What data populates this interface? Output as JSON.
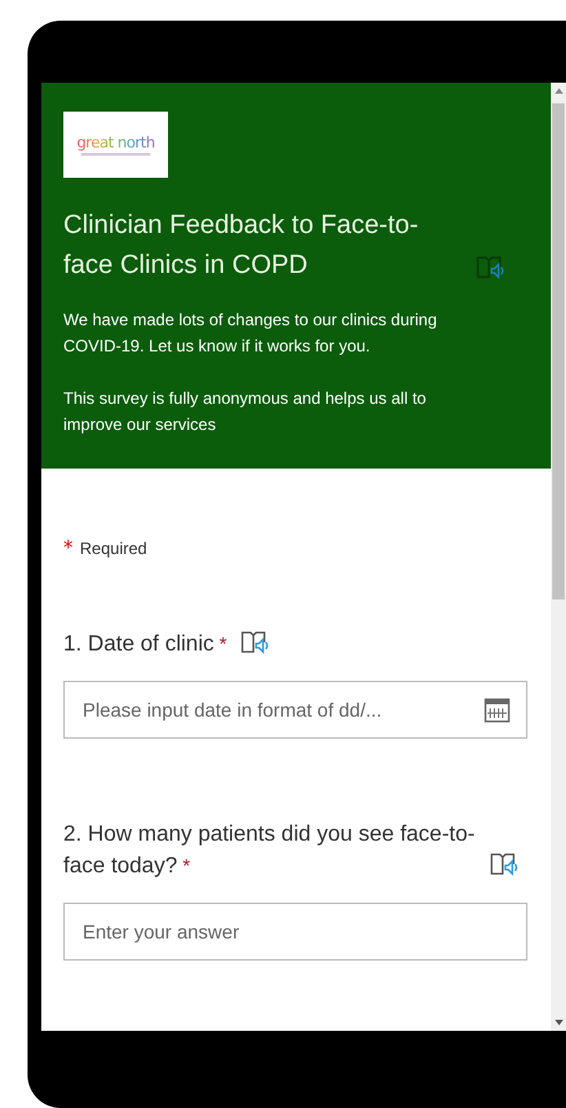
{
  "header": {
    "logo": {
      "text": "great north"
    },
    "title": "Clinician Feedback to Face-to-face Clinics in COPD",
    "paragraphs": [
      "We have made lots of changes to our clinics during COVID-19. Let us know if it works for you.",
      "This survey is fully anonymous and helps us all to improve our services"
    ]
  },
  "required_note": {
    "mark": "*",
    "text": "Required"
  },
  "questions": [
    {
      "number": "1.",
      "text": "Date of clinic",
      "required": true,
      "field": {
        "kind": "date",
        "placeholder": "Please input date in format of dd/..."
      }
    },
    {
      "number": "2.",
      "text": "How many patients did you see face-to-face today?",
      "required": true,
      "field": {
        "kind": "text",
        "placeholder": "Enter your answer"
      }
    }
  ]
}
